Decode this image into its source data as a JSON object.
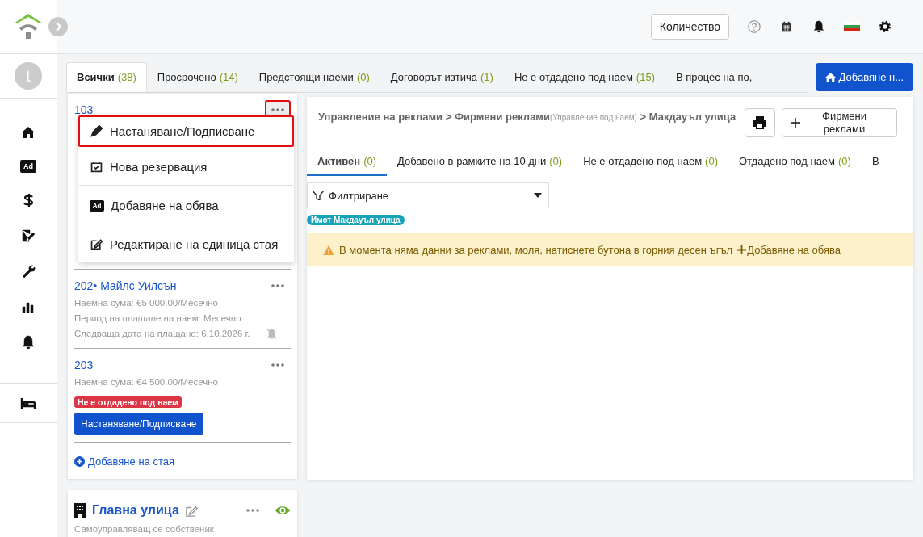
{
  "sidebar": {
    "avatar_letter": "t",
    "ad_badge": "Ad"
  },
  "topbar": {
    "quantity_button": "Количество"
  },
  "tabs": [
    {
      "label": "Всички",
      "count": "(38)",
      "selected": true
    },
    {
      "label": "Просрочено",
      "count": "(14)",
      "selected": false
    },
    {
      "label": "Предстоящи наеми",
      "count": "(0)",
      "selected": false
    },
    {
      "label": "Договорът изтича",
      "count": "(1)",
      "selected": false
    },
    {
      "label": "Не е отдадено под наем",
      "count": "(15)",
      "selected": false
    },
    {
      "label": "В процес на по,",
      "selected": false
    }
  ],
  "add_button": "Добавяне н...",
  "rooms": [
    {
      "number": "103",
      "menu_open": true,
      "highlighted": true
    },
    {
      "number": "202",
      "separator": "•",
      "tenant": "Майлс Уилсън",
      "lines": [
        "Наемна сума: €5 000.00/Месечно",
        "Период на плащане на наем: Месечно",
        "Следваща дата на плащане:  6.10.2026 г."
      ],
      "menu_open": false,
      "highlighted": false
    },
    {
      "number": "203",
      "lines": [
        "Наемна сума: €4 500.00/Месечно"
      ],
      "badge": "Не е отдадено под наем",
      "action": "Настаняване/Подписване",
      "menu_open": false,
      "highlighted": false
    }
  ],
  "menu": [
    {
      "label": "Настаняване/Подписване",
      "highlighted": true
    },
    {
      "label": "Нова резервация",
      "highlighted": false
    },
    {
      "label": "Добавяне на обява",
      "badge": "Ad",
      "highlighted": false
    },
    {
      "label": "Редактиране на единица стая",
      "highlighted": false
    }
  ],
  "add_room": "Добавяне на стая",
  "property": {
    "name": "Главна улица",
    "subtitle": "Самоуправляващ се собственик"
  },
  "breadcrumb": {
    "parts": [
      "Управление на реклами",
      ">",
      "Фирмени реклами"
    ],
    "note": "(Управление под наем)",
    "last": "> Макдауъл улица"
  },
  "company_ads_button": "Фирмени реклами",
  "sub_tabs": [
    {
      "label": "Активен",
      "count": "(0)",
      "selected": true
    },
    {
      "label": "Добавено в рамките на 10 дни",
      "count": "(0)",
      "selected": false
    },
    {
      "label": "Не е отдадено под наем",
      "count": "(0)",
      "selected": false
    },
    {
      "label": "Отдадено под наем",
      "count": "(0)",
      "selected": false
    },
    {
      "label": "В",
      "selected": false
    }
  ],
  "filter": {
    "label": "Филтриране"
  },
  "tag": "Имот Макдауъл улица",
  "alert": {
    "text": "В момента няма данни за реклами, моля, натиснете бутона в горния десен ъгъл",
    "link": "Добавяне на обява"
  }
}
